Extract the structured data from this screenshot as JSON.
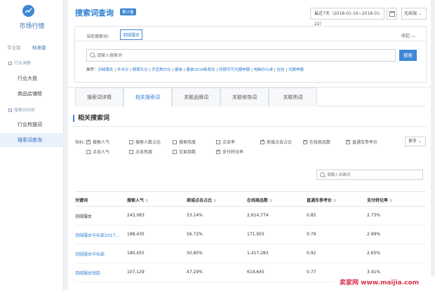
{
  "sidebar": {
    "brand": "市场行情",
    "versions": [
      "专业版",
      "标准版"
    ],
    "sections": [
      {
        "label": "行业洞察",
        "items": [
          "行业大盘",
          "商品店铺榜"
        ]
      },
      {
        "label": "搜索词分析",
        "items": [
          "行业热搜词",
          "搜索词查询"
        ]
      }
    ]
  },
  "header": {
    "title": "搜索词查询",
    "tag": "累计量",
    "date_range": "最近7天（2018-01-16~2018-01-22）",
    "terminal": "无线端"
  },
  "search_box": {
    "current_label": "当前搜索词：",
    "current_keyword": "羽绒服女",
    "fold_label": "收起",
    "placeholder": "请输入搜索词",
    "button": "搜索",
    "recommend_label": "推荐：",
    "recommendations": [
      "羽绒服女",
      "补水仪",
      "眼周头仪",
      "牙齿美白仪",
      "春装",
      "春装2018新款女",
      "妖精可可光腿神器",
      "电脑办公桌",
      "包包",
      "光腿神器"
    ]
  },
  "tabs": [
    "搜索词详情",
    "相关搜索词",
    "关联品牌词",
    "关联修饰词",
    "关联热词"
  ],
  "active_tab": 1,
  "section_title": "相关搜索词",
  "metrics": {
    "label": "指标：",
    "row1": [
      {
        "label": "搜索人气",
        "checked": true
      },
      {
        "label": "搜索人数占比",
        "checked": false
      },
      {
        "label": "搜索热度",
        "checked": false
      },
      {
        "label": "点击率",
        "checked": false
      },
      {
        "label": "商城点击占比",
        "checked": true
      },
      {
        "label": "在线商品数",
        "checked": true
      },
      {
        "label": "直通车参考价",
        "checked": true
      }
    ],
    "row2": [
      {
        "label": "点击人气",
        "checked": false
      },
      {
        "label": "点击热度",
        "checked": false
      },
      {
        "label": "交易指数",
        "checked": false
      },
      {
        "label": "支付转化率",
        "checked": true
      }
    ],
    "more": "更多"
  },
  "keyword_search_placeholder": "请输入关键词",
  "table": {
    "headers": [
      "关键词",
      "搜索人气",
      "商城点击占比",
      "在线商品数",
      "直通车参考价",
      "支付转化率"
    ],
    "rows": [
      [
        "羽绒服女",
        "243,083",
        "53.14%",
        "2,614,774",
        "0.85",
        "2.73%"
      ],
      [
        "羽绒服女中长款2017...",
        "188,435",
        "56.72%",
        "171,955",
        "0.79",
        "2.99%"
      ],
      [
        "羽绒服女中长款",
        "180,455",
        "50.85%",
        "1,417,283",
        "0.92",
        "2.65%"
      ],
      [
        "羽绒服女短款",
        "107,129",
        "47.29%",
        "619,645",
        "0.77",
        "3.41%"
      ]
    ]
  },
  "watermark": {
    "a": "卖家网",
    "b": "www.maijia.com"
  },
  "colors": {
    "accent": "#3f86d6",
    "link": "#2f7fd0"
  }
}
